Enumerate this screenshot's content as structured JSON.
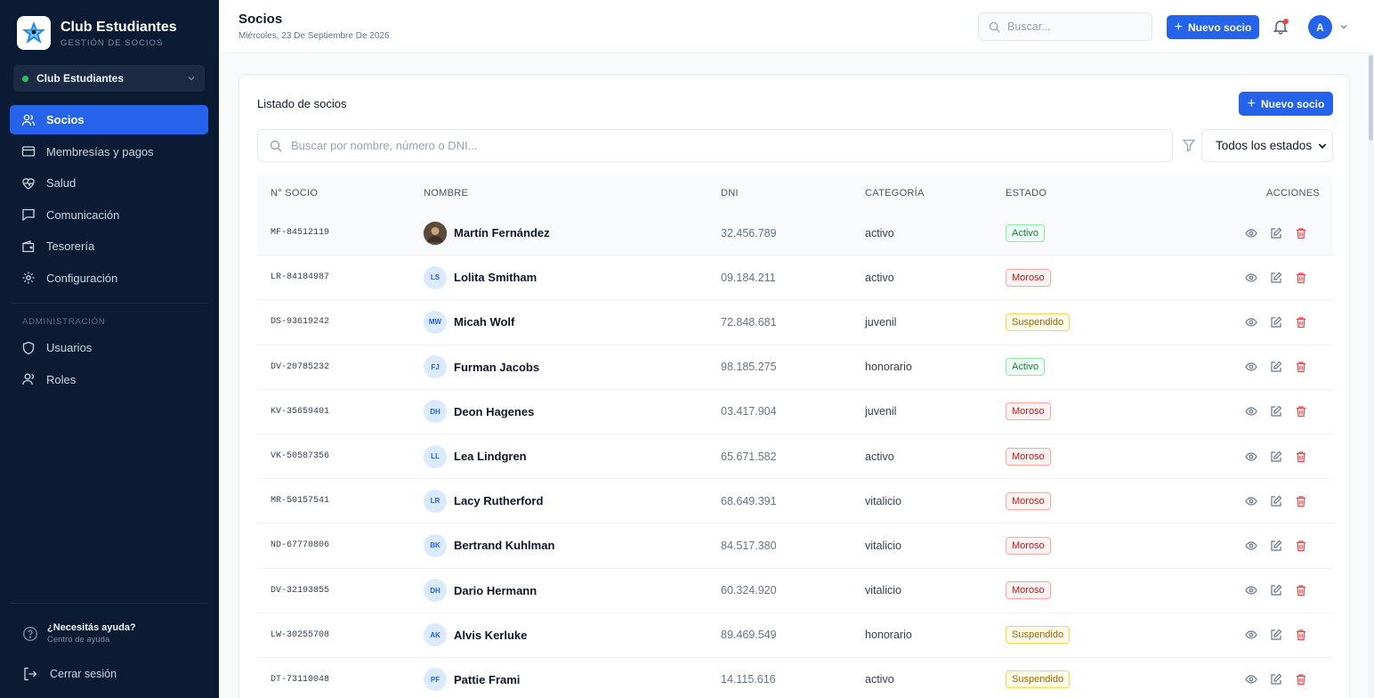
{
  "brand": {
    "name": "Club Estudiantes",
    "subtitle": "GESTIÓN DE SOCIOS"
  },
  "club_selector": {
    "value": "Club Estudiantes",
    "status_color": "#22c55e"
  },
  "sidebar": {
    "items": [
      {
        "label": "Socios",
        "icon": "users-icon",
        "active": true
      },
      {
        "label": "Membresías y pagos",
        "icon": "credit-card-icon"
      },
      {
        "label": "Salud",
        "icon": "heart-pulse-icon"
      },
      {
        "label": "Comunicación",
        "icon": "message-icon"
      },
      {
        "label": "Tesorería",
        "icon": "wallet-icon"
      },
      {
        "label": "Configuración",
        "icon": "gear-icon"
      }
    ],
    "admin_section": "ADMINISTRACIÓN",
    "admin_items": [
      {
        "label": "Usuarios",
        "icon": "shield-icon"
      },
      {
        "label": "Roles",
        "icon": "user-icon"
      }
    ],
    "help": {
      "title": "¿Necesitás ayuda?",
      "subtitle": "Centro de ayuda"
    },
    "logout": "Cerrar sesión"
  },
  "header": {
    "title": "Socios",
    "date": "Miércoles, 23 De Septiembre De 2026",
    "search_placeholder": "Buscar...",
    "new_button": "Nuevo socio",
    "avatar_initial": "A"
  },
  "main": {
    "card_title": "Listado de socios",
    "new_button": "Nuevo socio",
    "search_placeholder": "Buscar por nombre, número o DNI...",
    "status_filter": "Todos los estados",
    "columns": [
      "N° SOCIO",
      "NOMBRE",
      "DNI",
      "CATEGORÍA",
      "ESTADO",
      "ACCIONES"
    ],
    "rows": [
      {
        "num": "MF-84512119",
        "initials": "",
        "photo": true,
        "name": "Martín Fernández",
        "dni": "32.456.789",
        "cat": "activo",
        "state": "Activo"
      },
      {
        "num": "LR-84184987",
        "initials": "LS",
        "name": "Lolita Smitham",
        "dni": "09.184.211",
        "cat": "activo",
        "state": "Moroso"
      },
      {
        "num": "DS-93619242",
        "initials": "MW",
        "name": "Micah Wolf",
        "dni": "72.848.681",
        "cat": "juvenil",
        "state": "Suspendido"
      },
      {
        "num": "DV-20785232",
        "initials": "FJ",
        "name": "Furman Jacobs",
        "dni": "98.185.275",
        "cat": "honorario",
        "state": "Activo"
      },
      {
        "num": "KV-35659401",
        "initials": "DH",
        "name": "Deon Hagenes",
        "dni": "03.417.904",
        "cat": "juvenil",
        "state": "Moroso"
      },
      {
        "num": "VK-50587356",
        "initials": "LL",
        "name": "Lea Lindgren",
        "dni": "65.671.582",
        "cat": "activo",
        "state": "Moroso"
      },
      {
        "num": "MR-50157541",
        "initials": "LR",
        "name": "Lacy Rutherford",
        "dni": "68.649.391",
        "cat": "vitalicio",
        "state": "Moroso"
      },
      {
        "num": "ND-67770806",
        "initials": "BK",
        "name": "Bertrand Kuhlman",
        "dni": "84.517.380",
        "cat": "vitalicio",
        "state": "Moroso"
      },
      {
        "num": "DV-32193855",
        "initials": "DH",
        "name": "Dario Hermann",
        "dni": "60.324.920",
        "cat": "vitalicio",
        "state": "Moroso"
      },
      {
        "num": "LW-30255708",
        "initials": "AK",
        "name": "Alvis Kerluke",
        "dni": "89.469.549",
        "cat": "honorario",
        "state": "Suspendido"
      },
      {
        "num": "DT-73110048",
        "initials": "PF",
        "name": "Pattie Frami",
        "dni": "14.115.616",
        "cat": "activo",
        "state": "Suspendido"
      }
    ]
  },
  "colors": {
    "sidebar": "#0b1b34",
    "accent": "#2563eb",
    "activo": "#15803d",
    "moroso": "#b91c1c",
    "suspendido": "#a16207"
  }
}
